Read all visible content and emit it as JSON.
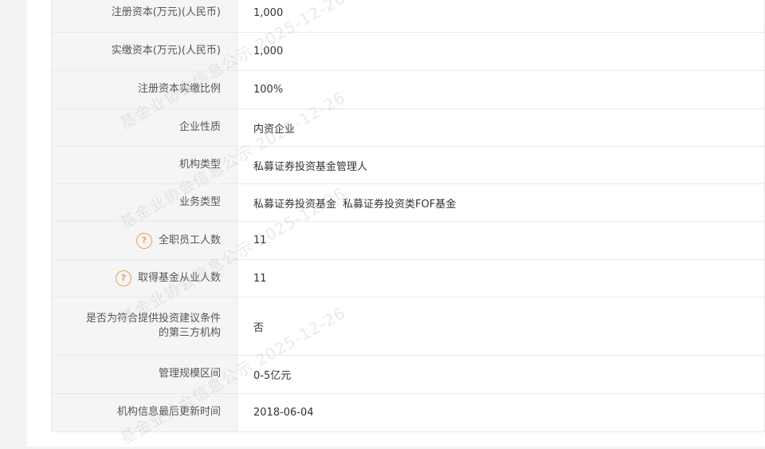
{
  "rows": [
    {
      "label": "注册资本(万元)(人民币)",
      "value": "1,000"
    },
    {
      "label": "实缴资本(万元)(人民币)",
      "value": "1,000"
    },
    {
      "label": "注册资本实缴比例",
      "value": "100%"
    },
    {
      "label": "企业性质",
      "value": "内资企业"
    },
    {
      "label": "机构类型",
      "value": "私募证券投资基金管理人"
    },
    {
      "label": "业务类型",
      "values": [
        "私募证券投资基金",
        "私募证券投资类FOF基金"
      ]
    },
    {
      "label": "全职员工人数",
      "value": "11",
      "help_icon": "question-circle-icon"
    },
    {
      "label": "取得基金从业人数",
      "value": "11",
      "help_icon": "question-circle-icon"
    },
    {
      "label_lines": [
        "是否为符合提供投资建议条件",
        "的第三方机构"
      ],
      "value": "否"
    },
    {
      "label": "管理规模区间",
      "value": "0-5亿元"
    },
    {
      "label": "机构信息最后更新时间",
      "value": "2018-06-04"
    }
  ],
  "watermark": {
    "text": "基金业协会信息公示 2025-12-26"
  },
  "colors": {
    "help_icon": "#e8a062",
    "label_bg": "#f5f5f5",
    "border": "#e9e9e9"
  }
}
